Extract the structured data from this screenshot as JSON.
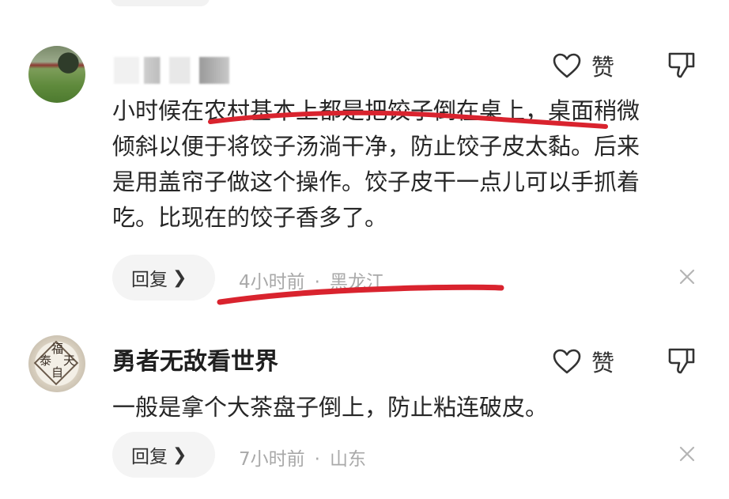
{
  "comments": [
    {
      "username": "",
      "text_lines": [
        "小时候在农村基本上都是把饺子倒在桌上，桌面稍微",
        "倾斜以便于将饺子汤淌干净，防止饺子皮太黏。后来",
        "是用盖帘子做这个操作。饺子皮干一点儿可以手抓着",
        "吃。比现在的饺子香多了。"
      ],
      "reply_label": "回复",
      "time": "4小时前",
      "location": "黑龙江",
      "like_label": "赞"
    },
    {
      "username": "勇者无敌看世界",
      "avatar_seal": [
        "福",
        "天",
        "泰",
        "自"
      ],
      "text_lines": [
        "一般是拿个大茶盘子倒上，防止粘连破皮。"
      ],
      "reply_label": "回复",
      "time": "7小时前",
      "location": "山东",
      "like_label": "赞"
    }
  ],
  "meta_separator": "·",
  "icons": {
    "like": "heart-outline-icon",
    "dislike": "thumbs-down-outline-icon",
    "reply_chevron": "chevron-right-icon",
    "close": "close-icon"
  },
  "colors": {
    "annotation": "#d9232e",
    "meta_text": "#a9a9a9",
    "reply_bg": "#f4f4f4"
  }
}
